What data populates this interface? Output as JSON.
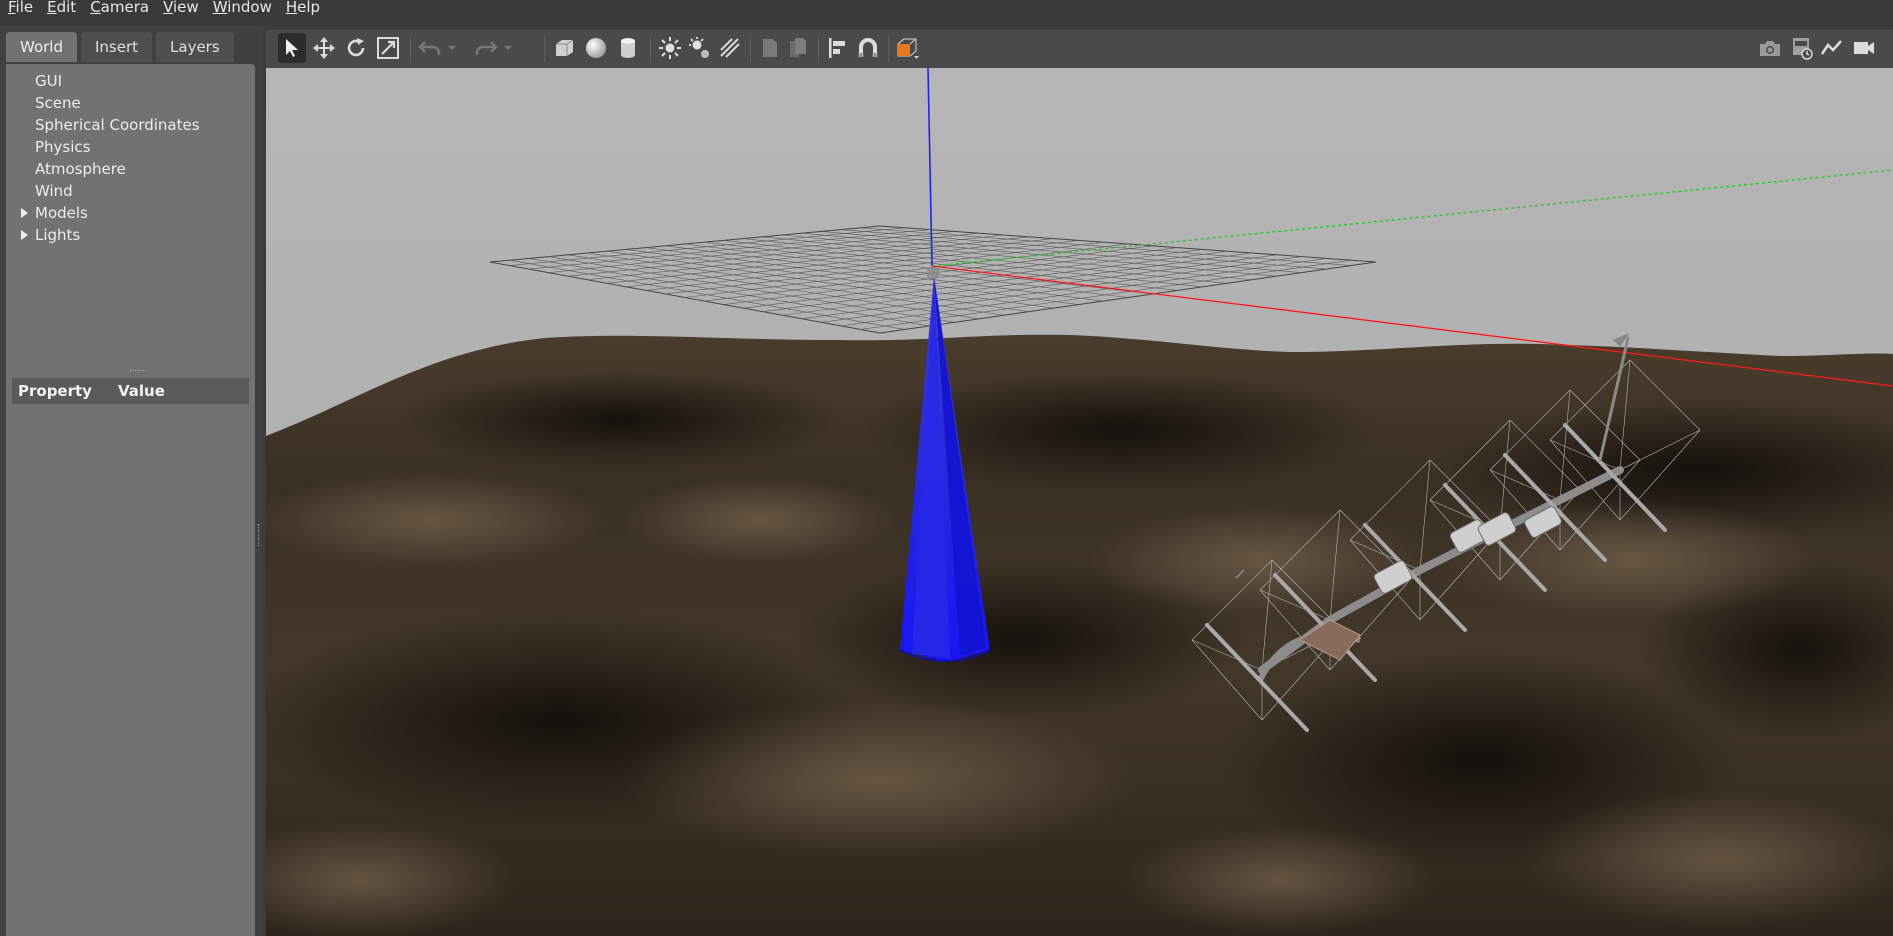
{
  "menu": [
    {
      "accel": "F",
      "rest": "ile"
    },
    {
      "accel": "E",
      "rest": "dit"
    },
    {
      "accel": "C",
      "rest": "amera"
    },
    {
      "accel": "V",
      "rest": "iew"
    },
    {
      "accel": "W",
      "rest": "indow"
    },
    {
      "accel": "H",
      "rest": "elp"
    }
  ],
  "tabs": {
    "world": "World",
    "insert": "Insert",
    "layers": "Layers"
  },
  "tree": {
    "gui": "GUI",
    "scene": "Scene",
    "spherical": "Spherical Coordinates",
    "physics": "Physics",
    "atmosphere": "Atmosphere",
    "wind": "Wind",
    "models": "Models",
    "lights": "Lights"
  },
  "properties": {
    "col_property": "Property",
    "col_value": "Value"
  },
  "toolbar_icons": [
    "select-mode-icon",
    "translate-mode-icon",
    "rotate-mode-icon",
    "scale-mode-icon",
    "undo-icon",
    "undo-dropdown-icon",
    "redo-icon",
    "redo-dropdown-icon",
    "box-shape-icon",
    "sphere-shape-icon",
    "cylinder-shape-icon",
    "point-light-icon",
    "spot-light-icon",
    "directional-light-icon",
    "copy-icon",
    "paste-icon",
    "align-icon",
    "snap-icon",
    "view-angle-icon",
    "screenshot-icon",
    "log-icon",
    "plot-icon",
    "record-video-icon"
  ],
  "colors": {
    "accent_orange": "#e8771e",
    "axis_x": "#ff1a1a",
    "axis_y": "#22cc22",
    "axis_z": "#2020ff",
    "sonar_cone": "#1a1aff",
    "sky": "#b4b4b4",
    "terrain": "#4a3d2e"
  }
}
